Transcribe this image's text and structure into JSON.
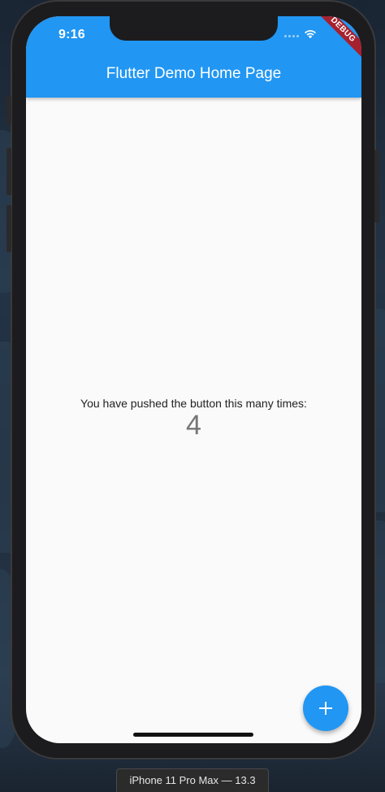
{
  "status_bar": {
    "time": "9:16",
    "icons": [
      "signal-dots-icon",
      "wifi-icon"
    ]
  },
  "debug_banner": {
    "label": "DEBUG",
    "color": "#a7202d"
  },
  "app_bar": {
    "title": "Flutter Demo Home Page",
    "color": "#2196f3"
  },
  "body": {
    "message": "You have pushed the button this many times:",
    "counter": "4"
  },
  "fab": {
    "icon": "plus-icon",
    "label": "+",
    "color": "#2196f3"
  },
  "simulator": {
    "device_label": "iPhone 11 Pro Max — 13.3"
  }
}
